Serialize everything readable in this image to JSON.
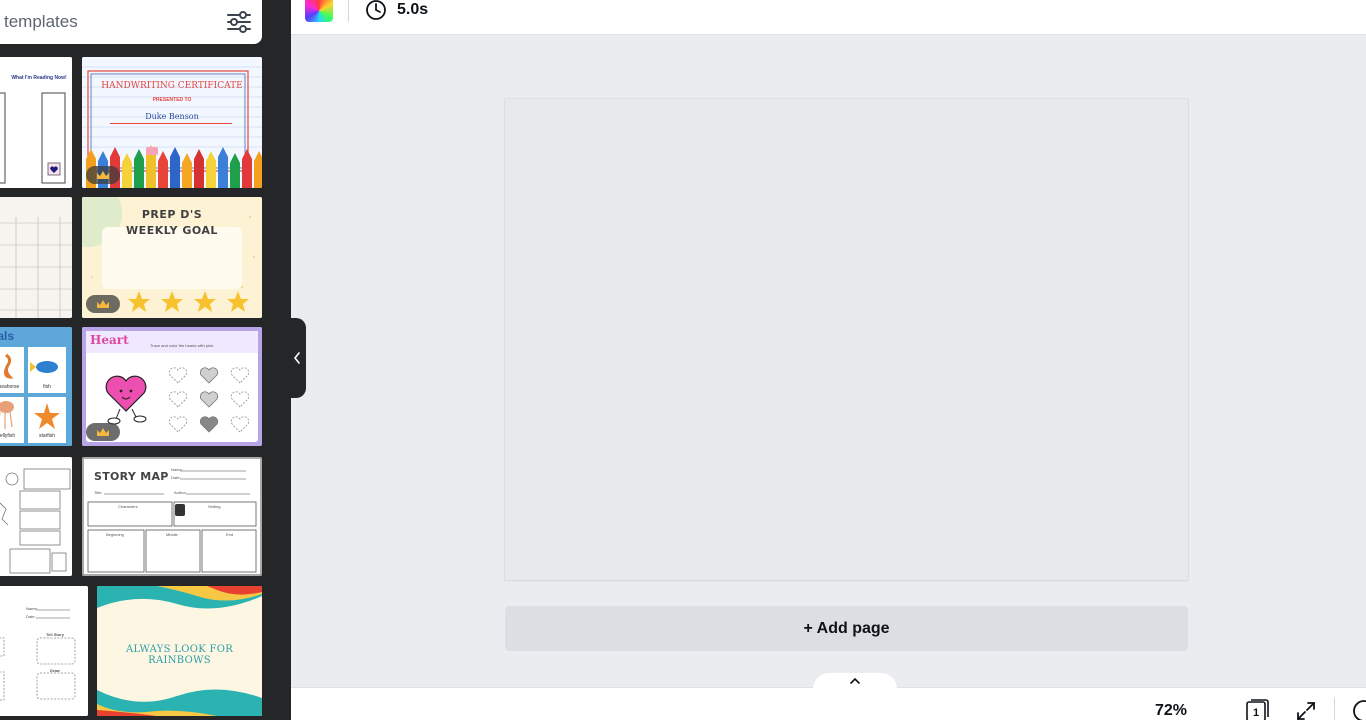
{
  "search": {
    "placeholder": "templates"
  },
  "toolbar": {
    "duration": "5.0s"
  },
  "templates": {
    "reading_log": {
      "title": "What I'm Reading Now!"
    },
    "handwriting_cert": {
      "title": "HANDWRITING CERTIFICATE",
      "presented": "PRESENTED TO",
      "name": "Duke Benson"
    },
    "weekly_goal": {
      "line1": "PREP D'S",
      "line2": "WEEKLY GOAL"
    },
    "ocean_animals": {
      "title": "nals",
      "labels": [
        "seahorse",
        "fish",
        "jellyfish",
        "starfish"
      ]
    },
    "heart": {
      "title": "Heart",
      "instruction": "Trace and color the hearts with pink."
    },
    "story_map": {
      "title": "STORY MAP",
      "labels": [
        "Name:",
        "Date:",
        "Title:",
        "Author:",
        "Characters",
        "Setting",
        "Beginning",
        "Middle",
        "End"
      ]
    },
    "worksheet": {
      "labels": [
        "Name:",
        "Date:",
        "Tell Story",
        "Draw"
      ]
    },
    "rainbows": {
      "title": "ALWAYS LOOK FOR RAINBOWS"
    }
  },
  "canvas": {
    "add_page_label": "+ Add page"
  },
  "bottom": {
    "zoom": "72%",
    "page_count": "1"
  },
  "colors": {
    "panel_bg": "#252627",
    "canvas_bg": "#ebecf0",
    "accent": "#0e1318"
  }
}
